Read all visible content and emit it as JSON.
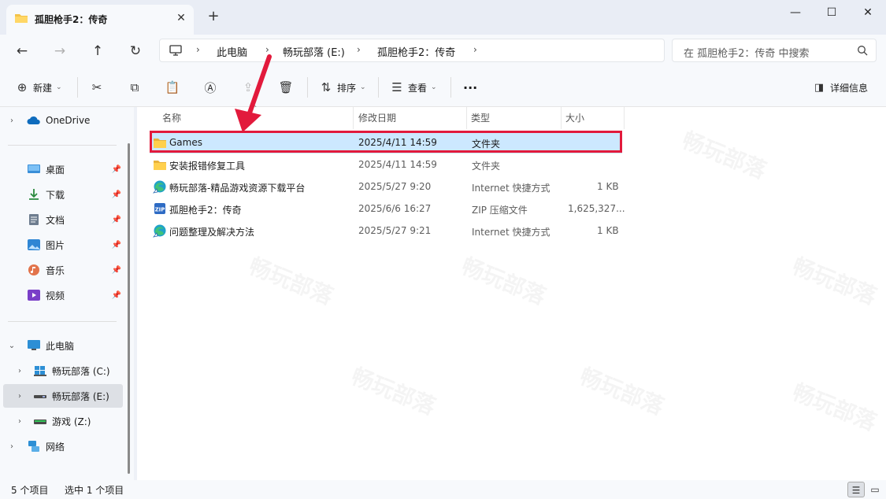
{
  "window": {
    "tab_title": "孤胆枪手2：传奇",
    "tab_close": "✕",
    "new_tab": "+",
    "minimize": "—",
    "maximize": "☐",
    "close": "✕"
  },
  "address": {
    "crumbs": [
      "此电脑",
      "畅玩部落 (E:)",
      "孤胆枪手2：传奇"
    ],
    "search_placeholder": "在 孤胆枪手2：传奇 中搜索"
  },
  "toolbar": {
    "new_label": "新建",
    "sort_label": "排序",
    "view_label": "查看",
    "more_label": "···",
    "details_label": "详细信息"
  },
  "sidebar": {
    "onedrive": "OneDrive",
    "quick": [
      {
        "label": "桌面",
        "icon": "desktop-icon"
      },
      {
        "label": "下载",
        "icon": "download-icon"
      },
      {
        "label": "文档",
        "icon": "document-icon"
      },
      {
        "label": "图片",
        "icon": "pictures-icon"
      },
      {
        "label": "音乐",
        "icon": "music-icon"
      },
      {
        "label": "视频",
        "icon": "video-icon"
      }
    ],
    "this_pc": "此电脑",
    "drives": [
      {
        "label": "畅玩部落 (C:)"
      },
      {
        "label": "畅玩部落 (E:)"
      },
      {
        "label": "游戏 (Z:)"
      }
    ],
    "network": "网络"
  },
  "columns": {
    "name": "名称",
    "date": "修改日期",
    "type": "类型",
    "size": "大小"
  },
  "files": [
    {
      "name": "Games",
      "date": "2025/4/11 14:59",
      "type": "文件夹",
      "size": "",
      "icon": "folder-icon"
    },
    {
      "name": "安装报错修复工具",
      "date": "2025/4/11 14:59",
      "type": "文件夹",
      "size": "",
      "icon": "folder-icon"
    },
    {
      "name": "畅玩部落-精品游戏资源下载平台",
      "date": "2025/5/27 9:20",
      "type": "Internet 快捷方式",
      "size": "1 KB",
      "icon": "edge-shortcut-icon"
    },
    {
      "name": "孤胆枪手2：传奇",
      "date": "2025/6/6 16:27",
      "type": "ZIP 压缩文件",
      "size": "1,625,327...",
      "icon": "zip-icon"
    },
    {
      "name": "问题整理及解决方法",
      "date": "2025/5/27 9:21",
      "type": "Internet 快捷方式",
      "size": "1 KB",
      "icon": "edge-shortcut-icon"
    }
  ],
  "status": {
    "count": "5 个项目",
    "selected": "选中 1 个项目"
  },
  "watermark": "畅玩部落",
  "colors": {
    "highlight": "#e21a3c",
    "selection": "#cce8ff",
    "folder": "#f4c34a"
  }
}
